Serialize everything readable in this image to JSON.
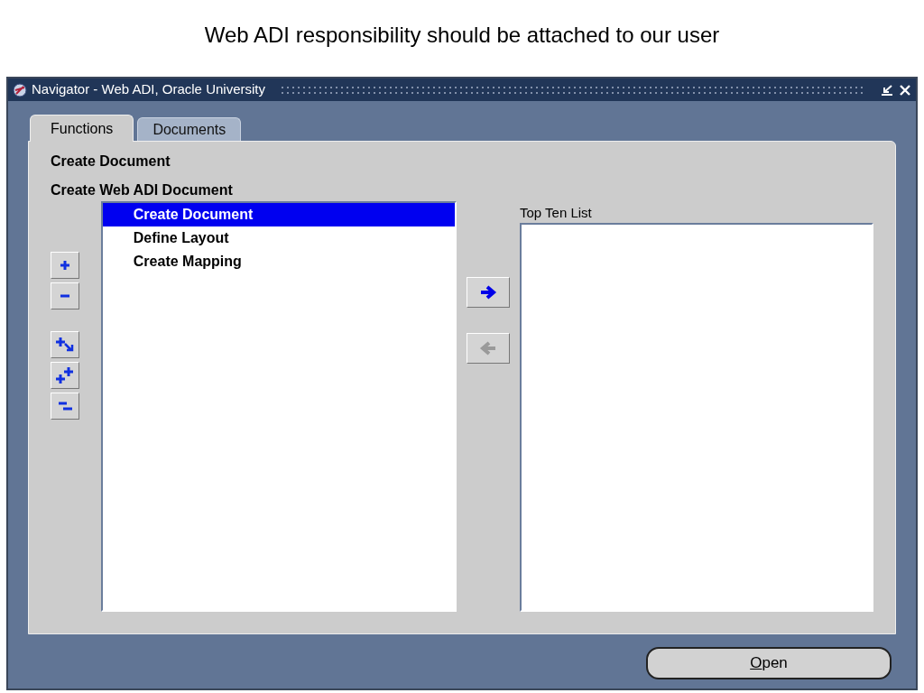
{
  "slide_title": "Web ADI responsibility should be attached to our user",
  "window": {
    "title": "Navigator - Web ADI, Oracle University"
  },
  "tabs": [
    {
      "label": "Functions",
      "selected": true
    },
    {
      "label": "Documents",
      "selected": false
    }
  ],
  "breadcrumbs": [
    "Create Document",
    "Create Web ADI Document"
  ],
  "functions_list": [
    {
      "label": "Create Document",
      "selected": true
    },
    {
      "label": "Define Layout",
      "selected": false
    },
    {
      "label": "Create Mapping",
      "selected": false
    }
  ],
  "transfer_buttons": [
    {
      "kind": "add",
      "disabled": false
    },
    {
      "kind": "remove",
      "disabled": true
    }
  ],
  "top_ten": {
    "label": "Top Ten List"
  },
  "open_button": {
    "label": "Open"
  }
}
